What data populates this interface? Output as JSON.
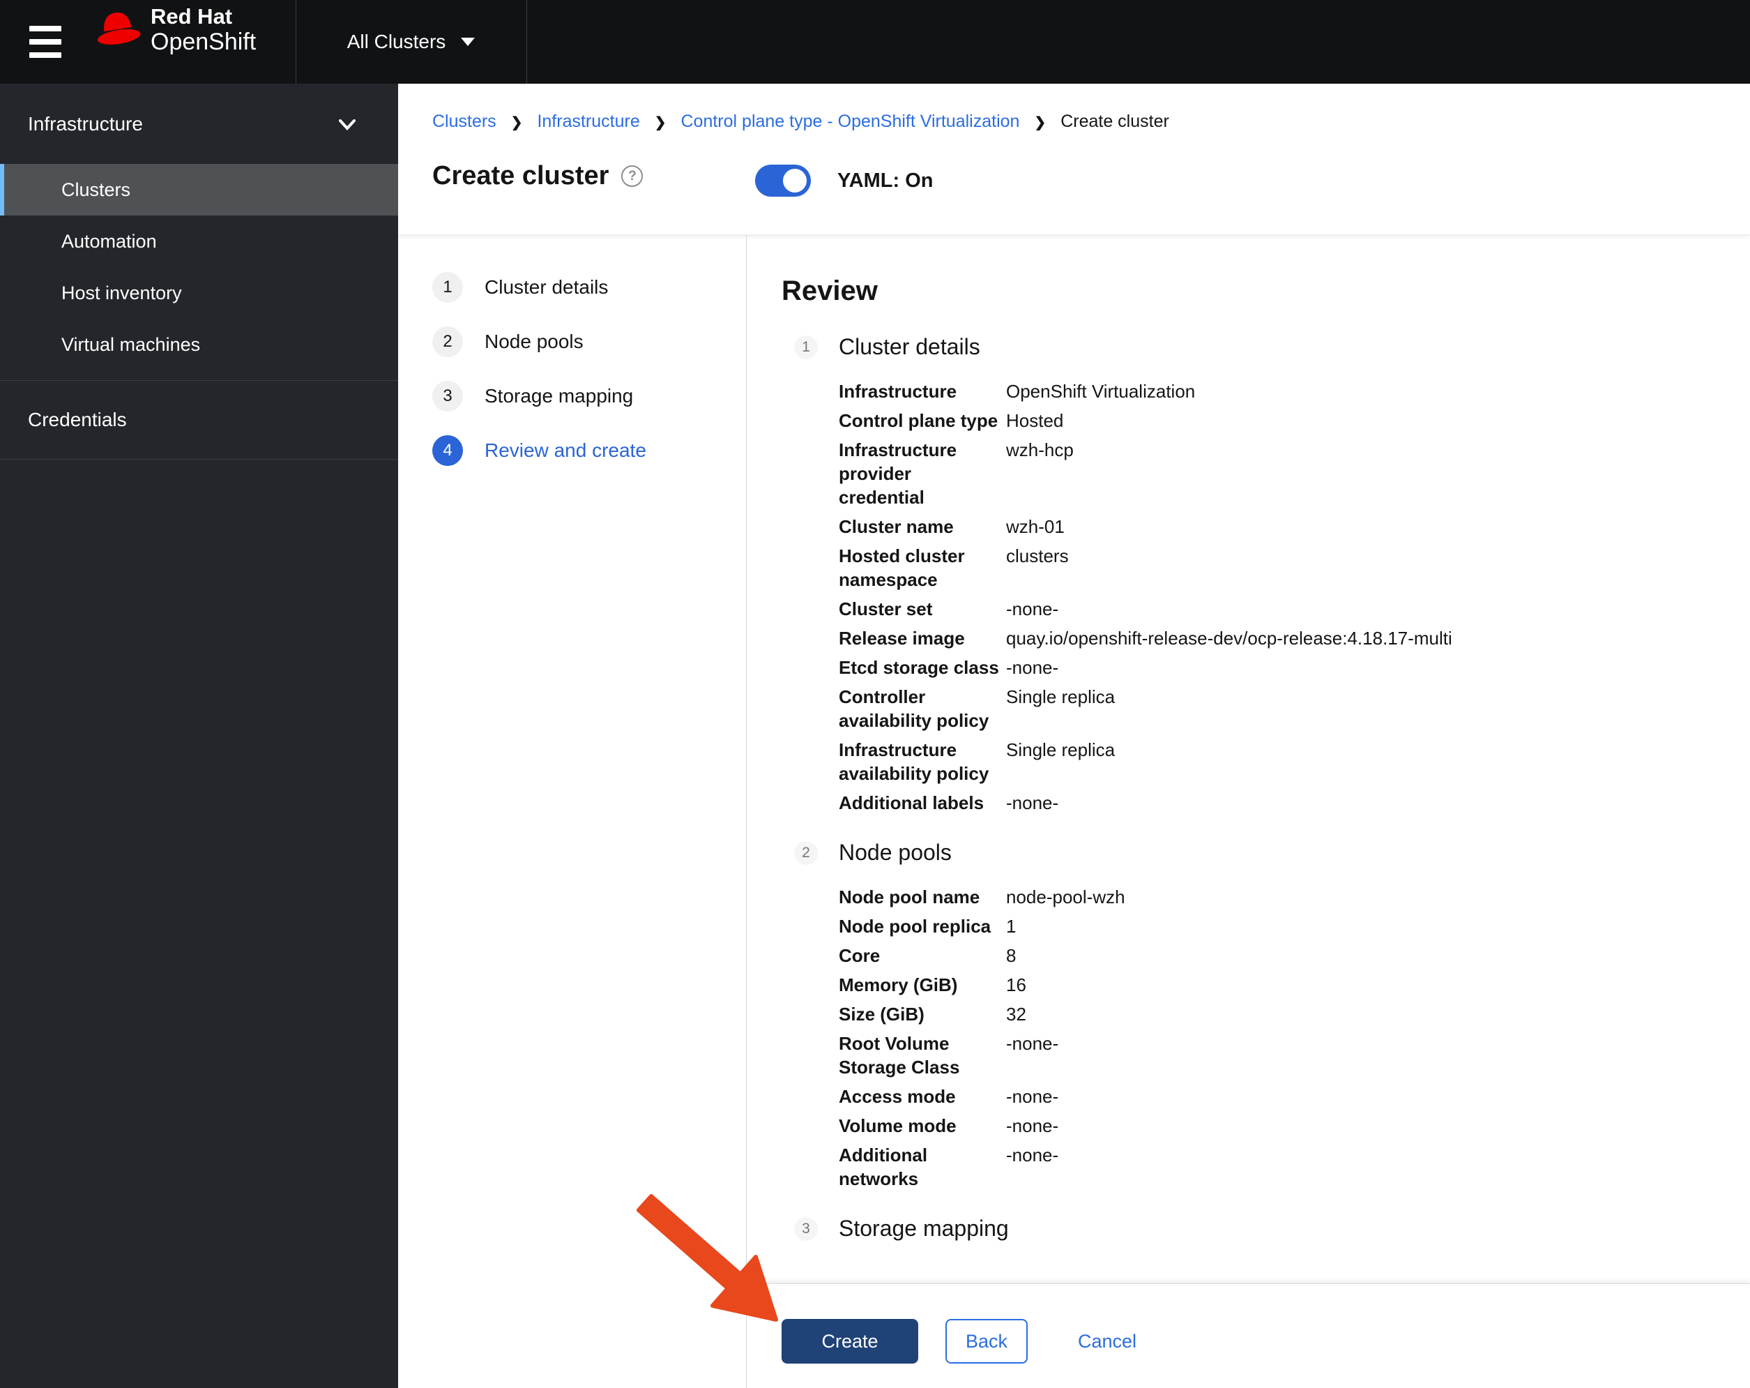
{
  "masthead": {
    "menu_icon": "hamburger-icon",
    "brand": {
      "hat_icon": "redhat-fedora-icon",
      "line1": "Red Hat",
      "line2": "OpenShift"
    },
    "perspective": {
      "label": "All Clusters",
      "caret_icon": "caret-down-icon"
    }
  },
  "sidebar": {
    "groups": [
      {
        "label": "Infrastructure",
        "chevron_icon": "chevron-down-icon",
        "expanded": true,
        "items": [
          {
            "label": "Clusters",
            "selected": true
          },
          {
            "label": "Automation",
            "selected": false
          },
          {
            "label": "Host inventory",
            "selected": false
          },
          {
            "label": "Virtual machines",
            "selected": false
          }
        ]
      },
      {
        "label": "Credentials",
        "items": []
      }
    ]
  },
  "breadcrumb": {
    "separator_icon": "chevron-right-icon",
    "items": [
      {
        "label": "Clusters",
        "link": true
      },
      {
        "label": "Infrastructure",
        "link": true
      },
      {
        "label": "Control plane type - OpenShift Virtualization",
        "link": true
      },
      {
        "label": "Create cluster",
        "link": false
      }
    ]
  },
  "page": {
    "title": "Create cluster",
    "help_icon": "help-question-icon",
    "yaml_toggle": {
      "label": "YAML: On",
      "state": "on"
    }
  },
  "wizard": {
    "steps": [
      {
        "num": "1",
        "label": "Cluster details",
        "active": false
      },
      {
        "num": "2",
        "label": "Node pools",
        "active": false
      },
      {
        "num": "3",
        "label": "Storage mapping",
        "active": false
      },
      {
        "num": "4",
        "label": "Review and create",
        "active": true
      }
    ]
  },
  "review": {
    "title": "Review",
    "sections": [
      {
        "num": "1",
        "title": "Cluster details",
        "rows": [
          {
            "label": "Infrastructure",
            "value": "OpenShift Virtualization"
          },
          {
            "label": "Control plane type",
            "value": "Hosted"
          },
          {
            "label": "Infrastructure provider credential",
            "value": "wzh-hcp"
          },
          {
            "label": "Cluster name",
            "value": "wzh-01"
          },
          {
            "label": "Hosted cluster namespace",
            "value": "clusters"
          },
          {
            "label": "Cluster set",
            "value": "-none-"
          },
          {
            "label": "Release image",
            "value": "quay.io/openshift-release-dev/ocp-release:4.18.17-multi"
          },
          {
            "label": "Etcd storage class",
            "value": "-none-"
          },
          {
            "label": "Controller availability policy",
            "value": "Single replica"
          },
          {
            "label": "Infrastructure availability policy",
            "value": "Single replica"
          },
          {
            "label": "Additional labels",
            "value": "-none-"
          }
        ]
      },
      {
        "num": "2",
        "title": "Node pools",
        "rows": [
          {
            "label": "Node pool name",
            "value": "node-pool-wzh"
          },
          {
            "label": "Node pool replica",
            "value": "1"
          },
          {
            "label": "Core",
            "value": "8"
          },
          {
            "label": "Memory (GiB)",
            "value": "16"
          },
          {
            "label": "Size (GiB)",
            "value": "32"
          },
          {
            "label": "Root Volume Storage Class",
            "value": "-none-"
          },
          {
            "label": "Access mode",
            "value": "-none-"
          },
          {
            "label": "Volume mode",
            "value": "-none-"
          },
          {
            "label": "Additional networks",
            "value": "-none-"
          }
        ]
      },
      {
        "num": "3",
        "title": "Storage mapping",
        "rows": []
      }
    ]
  },
  "footer": {
    "create": "Create",
    "back": "Back",
    "cancel": "Cancel"
  },
  "annotation": {
    "type": "arrow",
    "icon": "arrow-annotation",
    "color": "#e8481c",
    "points_to": "create-button"
  },
  "colors": {
    "accent": "#2b64d6",
    "link": "#2b6de0",
    "create_button": "#1f4277",
    "masthead": "#111214",
    "sidebar": "#23262a",
    "selected_item_bg": "#4f5255",
    "selected_item_border": "#73bcf7",
    "arrow": "#e8481c",
    "redhat_red": "#ee0000"
  }
}
